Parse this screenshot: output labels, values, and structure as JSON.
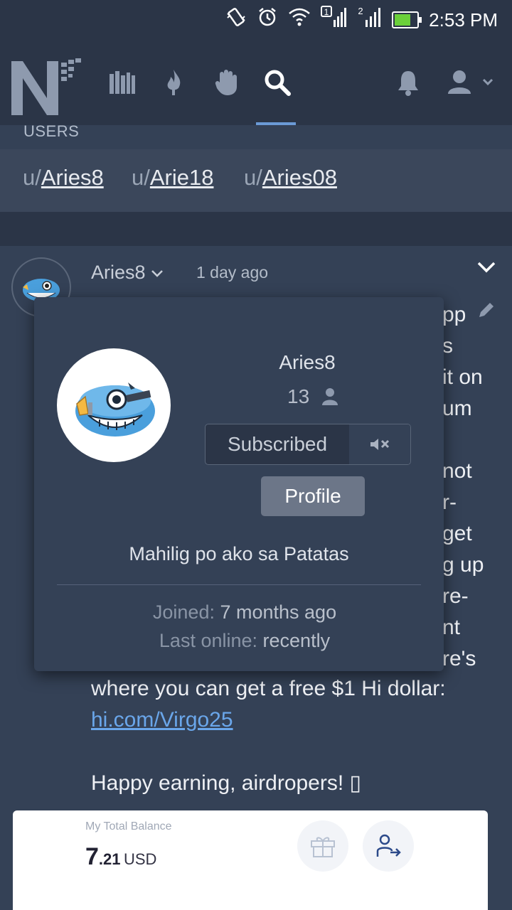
{
  "status_bar": {
    "time": "2:53 PM",
    "icons": [
      "vibrate-icon",
      "alarm-icon",
      "wifi-icon",
      "signal-sim1-icon",
      "signal-sim2-icon",
      "battery-charging-icon"
    ],
    "sim1": "1",
    "sim2": "2"
  },
  "nav": {
    "logo_letter": "N",
    "items": [
      "library-icon",
      "flame-icon",
      "hand-icon",
      "search-icon"
    ],
    "active": "search-icon",
    "right": [
      "bell-icon",
      "user-menu-icon"
    ]
  },
  "users_section": {
    "label": "USERS",
    "prefix": "u/",
    "results": [
      "Aries8",
      "Arie18",
      "Aries08"
    ]
  },
  "post": {
    "author": "Aries8",
    "time": "1 day ago",
    "partial_lines": [
      "pp",
      "s",
      "it on",
      "um",
      "not",
      "r-",
      "get",
      "g up",
      "re-",
      "nt",
      "re's"
    ],
    "line_where": "where you can get a free $1 Hi dollar:",
    "link": "hi.com/Virgo25",
    "closing": "Happy earning, airdropers! ▯"
  },
  "popup": {
    "name": "Aries8",
    "subscribers": "13",
    "subscribe_label": "Subscribed",
    "profile_label": "Profile",
    "bio": "Mahilig po ako sa Patatas",
    "joined_key": "Joined:",
    "joined_value": "7 months ago",
    "last_online_key": "Last online:",
    "last_online_value": "recently"
  },
  "embedded_screenshot": {
    "label": "My Total Balance",
    "balance_int": "7",
    "balance_dec": ".21",
    "currency": "USD"
  }
}
